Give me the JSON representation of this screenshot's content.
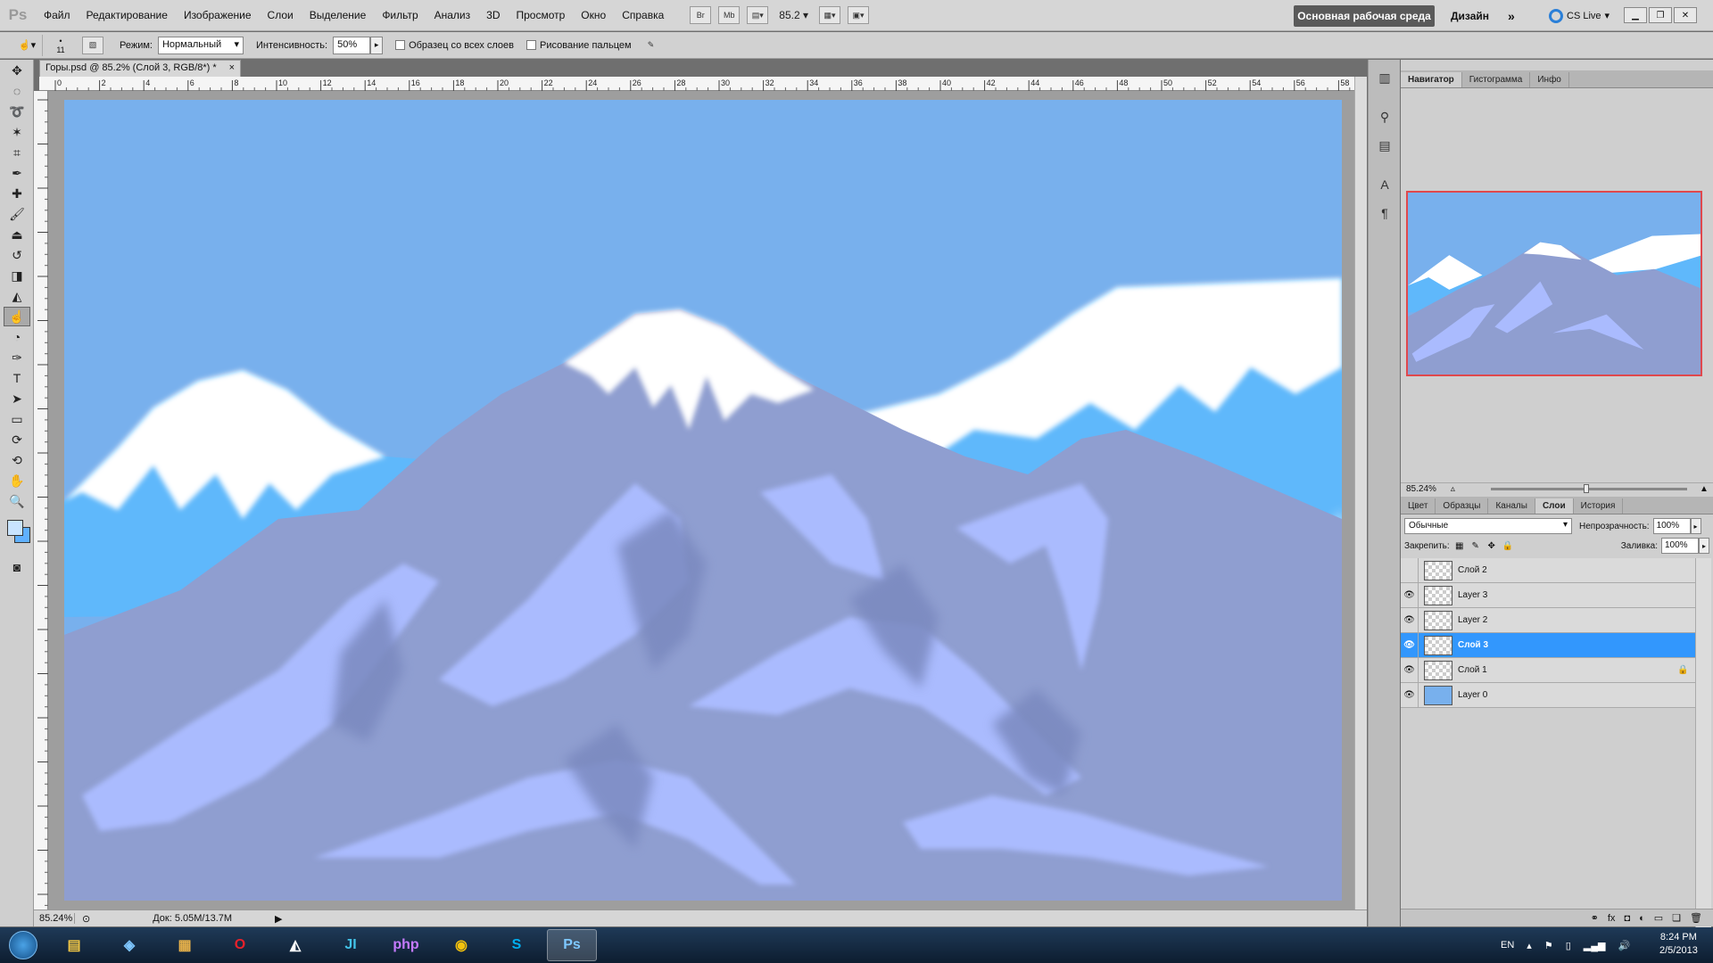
{
  "app": {
    "logo": "Ps"
  },
  "menu": [
    "Файл",
    "Редактирование",
    "Изображение",
    "Слои",
    "Выделение",
    "Фильтр",
    "Анализ",
    "3D",
    "Просмотр",
    "Окно",
    "Справка"
  ],
  "menubar_buttons": {
    "bridge": "Br",
    "minibridge": "Mb"
  },
  "zoom_display": "85.2",
  "workspace": {
    "active": "Основная рабочая среда",
    "other": "Дизайн",
    "more": "»"
  },
  "cs_live": "CS Live",
  "options": {
    "brush_size": "11",
    "mode_label": "Режим:",
    "mode_value": "Нормальный",
    "intensity_label": "Интенсивность:",
    "intensity_value": "50%",
    "sample_all_label": "Образец со всех слоев",
    "finger_painting_label": "Рисование пальцем"
  },
  "document": {
    "tab_title": "Горы.psd @ 85.2% (Слой 3, RGB/8*) *",
    "close": "×"
  },
  "ruler_ticks": [
    "0",
    "2",
    "4",
    "6",
    "8",
    "10",
    "12",
    "14",
    "16",
    "18",
    "20",
    "22",
    "24",
    "26",
    "28",
    "30",
    "32",
    "34",
    "36",
    "38",
    "40",
    "42",
    "44",
    "46",
    "48",
    "50",
    "52",
    "54",
    "56",
    "58"
  ],
  "status": {
    "zoom": "85.24%",
    "doc": "Док: 5.05M/13.7M"
  },
  "navigator": {
    "tabs": [
      "Навигатор",
      "Гистограмма",
      "Инфо"
    ],
    "active_tab": "Навигатор",
    "zoom": "85.24%"
  },
  "layers_panel": {
    "tabs": [
      "Цвет",
      "Образцы",
      "Каналы",
      "Слои",
      "История"
    ],
    "active_tab": "Слои",
    "blend_mode": "Обычные",
    "opacity_label": "Непрозрачность:",
    "opacity_value": "100%",
    "lock_label": "Закрепить:",
    "fill_label": "Заливка:",
    "fill_value": "100%",
    "layers": [
      {
        "name": "Слой 2",
        "visible": false,
        "selected": false,
        "locked": false,
        "thumb": "transparent"
      },
      {
        "name": "Layer 3",
        "visible": true,
        "selected": false,
        "locked": false,
        "thumb": "transparent"
      },
      {
        "name": "Layer 2",
        "visible": true,
        "selected": false,
        "locked": false,
        "thumb": "transparent"
      },
      {
        "name": "Слой 3",
        "visible": true,
        "selected": true,
        "locked": false,
        "thumb": "transparent"
      },
      {
        "name": "Слой 1",
        "visible": true,
        "selected": false,
        "locked": true,
        "thumb": "transparent"
      },
      {
        "name": "Layer 0",
        "visible": true,
        "selected": false,
        "locked": false,
        "thumb": "blue"
      }
    ],
    "footer_icons": [
      "link-icon",
      "fx-icon",
      "mask-icon",
      "adjustment-icon",
      "group-icon",
      "new-layer-icon",
      "trash-icon"
    ]
  },
  "colors": {
    "foreground": "#c9e4ff",
    "background": "#5fb0ff",
    "sky": "#78b0ed",
    "mountain": "#8f9ed0",
    "snow": "#ffffff",
    "selection": "#3297fd"
  },
  "taskbar": {
    "apps": [
      "explorer",
      "app-blue",
      "app-archive",
      "opera",
      "app-fox",
      "jetbrains",
      "php-storm",
      "chrome",
      "skype",
      "photoshop"
    ],
    "active_app": "photoshop",
    "lang": "EN",
    "time": "8:24 PM",
    "date": "2/5/2013"
  }
}
